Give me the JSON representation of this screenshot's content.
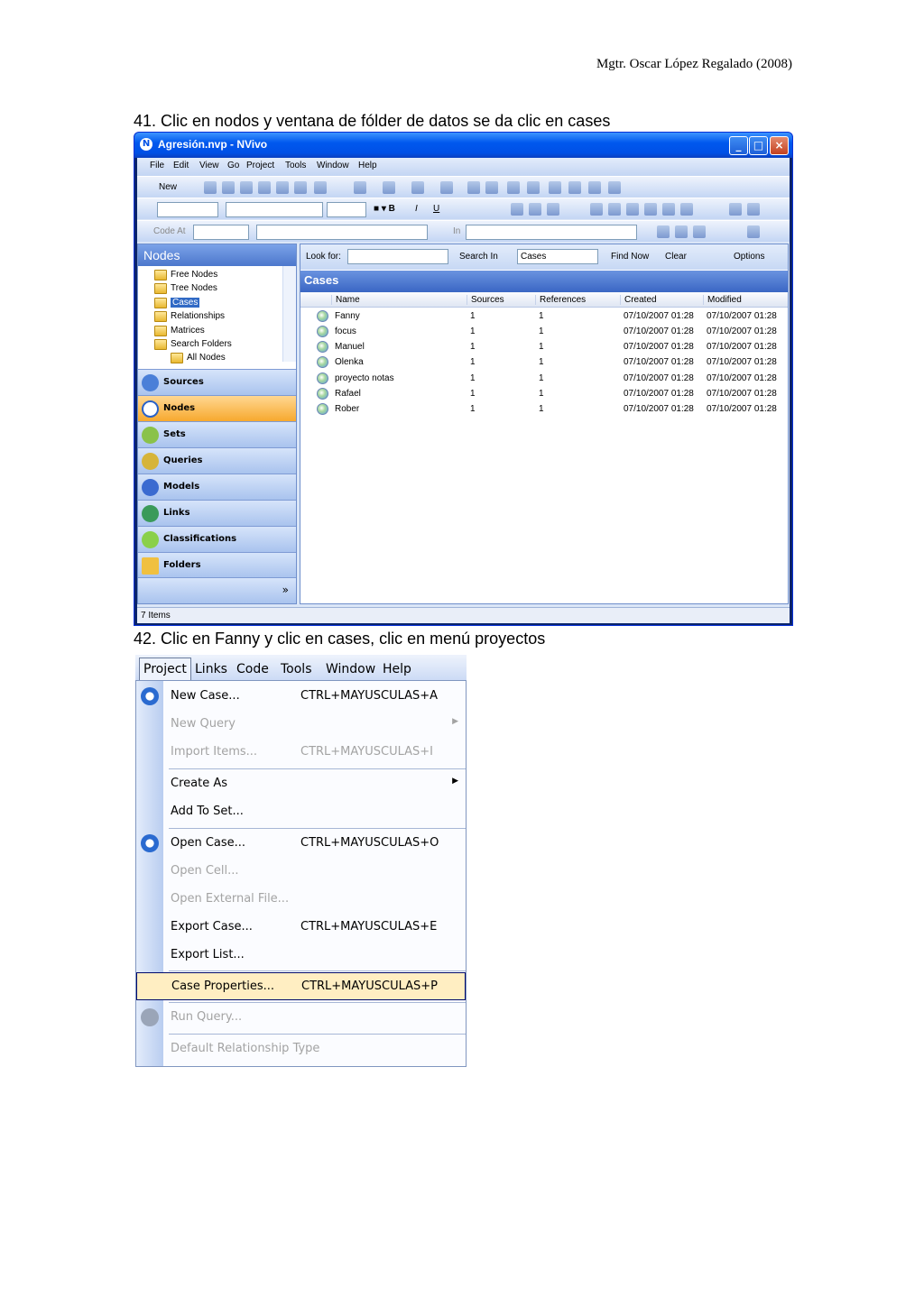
{
  "header": {
    "author": "Mgtr. Oscar López Regalado (2008)"
  },
  "steps": {
    "step41": "41. Clic en nodos y ventana de fólder de datos se da clic en cases",
    "step42": "42. Clic en Fanny y clic en cases, clic en menú proyectos"
  },
  "window": {
    "title": "Agresión.nvp - NVivo",
    "menu": [
      "File",
      "Edit",
      "View",
      "Go",
      "Project",
      "Tools",
      "Window",
      "Help"
    ],
    "new_label": "New",
    "code_at_label": "Code At",
    "in_label": "In",
    "nodes_header": "Nodes",
    "tree": [
      "Free Nodes",
      "Tree Nodes",
      "Cases",
      "Relationships",
      "Matrices",
      "Search Folders",
      "All Nodes"
    ],
    "nav": [
      "Sources",
      "Nodes",
      "Sets",
      "Queries",
      "Models",
      "Links",
      "Classifications",
      "Folders"
    ],
    "find": {
      "look_for": "Look for:",
      "search_in": "Search In",
      "scope": "Cases",
      "find_now": "Find Now",
      "clear": "Clear",
      "options": "Options"
    },
    "cases_header": "Cases",
    "columns": [
      "Name",
      "Sources",
      "References",
      "Created",
      "Modified"
    ],
    "rows": [
      {
        "name": "Fanny",
        "sources": "1",
        "refs": "1",
        "created": "07/10/2007 01:28",
        "modified": "07/10/2007 01:28"
      },
      {
        "name": "focus",
        "sources": "1",
        "refs": "1",
        "created": "07/10/2007 01:28",
        "modified": "07/10/2007 01:28"
      },
      {
        "name": "Manuel",
        "sources": "1",
        "refs": "1",
        "created": "07/10/2007 01:28",
        "modified": "07/10/2007 01:28"
      },
      {
        "name": "Olenka",
        "sources": "1",
        "refs": "1",
        "created": "07/10/2007 01:28",
        "modified": "07/10/2007 01:28"
      },
      {
        "name": "proyecto notas",
        "sources": "1",
        "refs": "1",
        "created": "07/10/2007 01:28",
        "modified": "07/10/2007 01:28"
      },
      {
        "name": "Rafael",
        "sources": "1",
        "refs": "1",
        "created": "07/10/2007 01:28",
        "modified": "07/10/2007 01:28"
      },
      {
        "name": "Rober",
        "sources": "1",
        "refs": "1",
        "created": "07/10/2007 01:28",
        "modified": "07/10/2007 01:28"
      }
    ],
    "status": "7 Items"
  },
  "menushot": {
    "bar": [
      "Project",
      "Links",
      "Code",
      "Tools",
      "Window",
      "Help"
    ],
    "items": [
      {
        "label": "New Case...",
        "shortcut": "CTRL+MAYUSCULAS+A"
      },
      {
        "label": "New Query",
        "shortcut": ""
      },
      {
        "label": "Import Items...",
        "shortcut": "CTRL+MAYUSCULAS+I"
      },
      {
        "label": "Create As",
        "shortcut": ""
      },
      {
        "label": "Add To Set...",
        "shortcut": ""
      },
      {
        "label": "Open Case...",
        "shortcut": "CTRL+MAYUSCULAS+O"
      },
      {
        "label": "Open Cell...",
        "shortcut": ""
      },
      {
        "label": "Open External File...",
        "shortcut": ""
      },
      {
        "label": "Export Case...",
        "shortcut": "CTRL+MAYUSCULAS+E"
      },
      {
        "label": "Export List...",
        "shortcut": ""
      },
      {
        "label": "Case Properties...",
        "shortcut": "CTRL+MAYUSCULAS+P"
      },
      {
        "label": "Run Query...",
        "shortcut": ""
      },
      {
        "label": "Default Relationship Type",
        "shortcut": ""
      }
    ]
  },
  "colors": {
    "xp_blue": "#0058ee",
    "nav_active": "#f7a92e",
    "highlight": "#ffeec2"
  }
}
